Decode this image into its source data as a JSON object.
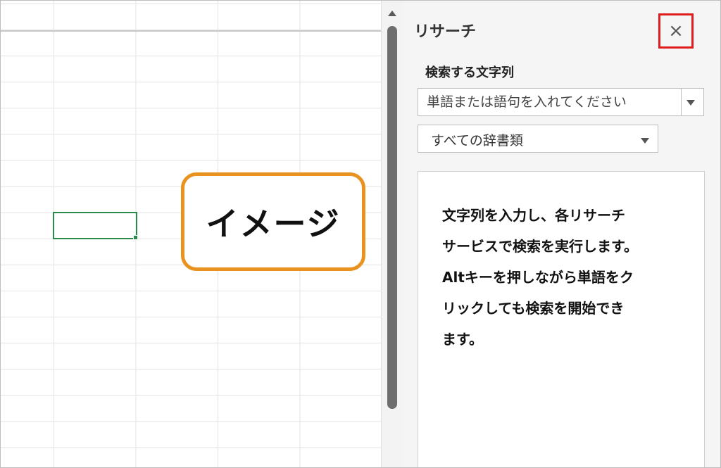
{
  "spreadsheet": {
    "callout_label": "イメージ"
  },
  "research_pane": {
    "title": "リサーチ",
    "close_icon": "×",
    "search_label": "検索する文字列",
    "search_placeholder": "単語または語句を入れてください",
    "dictionary_selected": "すべての辞書類",
    "instructions": "文字列を入力し、各リサーチ\nサービスで検索を実行します。\nAltキーを押しながら単語をク\nリックしても検索を開始でき\nます。"
  },
  "colors": {
    "callout_border": "#e8921f",
    "close_highlight": "#e01d1d",
    "selected_cell": "#2a8a4a"
  }
}
